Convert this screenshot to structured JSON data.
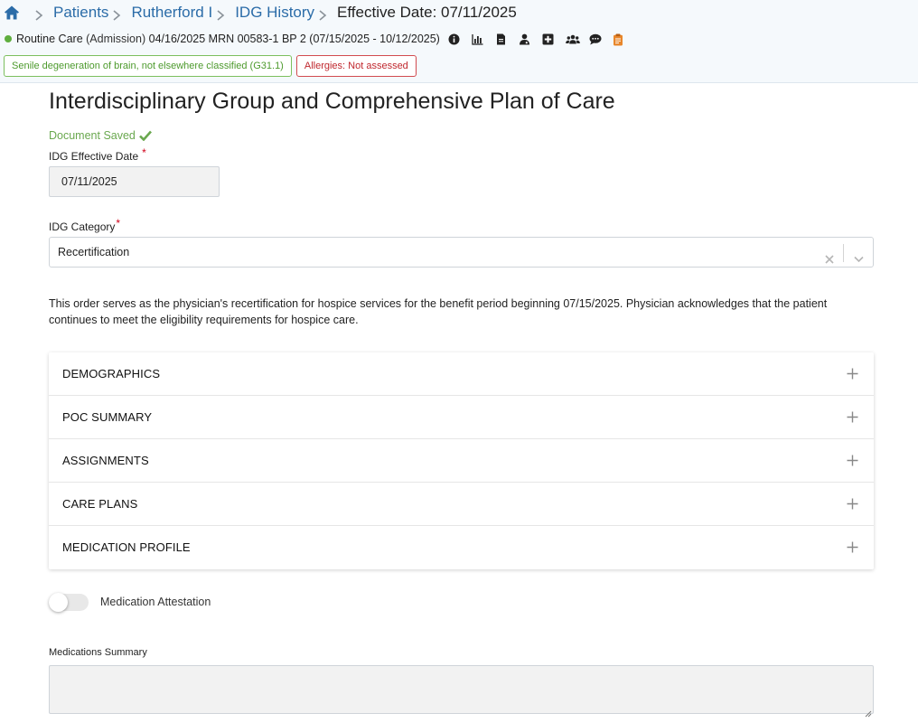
{
  "breadcrumb": {
    "items": [
      "Patients",
      "Rutherford I",
      "IDG History"
    ],
    "current": "Effective Date: 07/11/2025"
  },
  "patient": {
    "care_level": "Routine Care",
    "admission": "(Admission)",
    "details": "04/16/2025 MRN 00583-1 BP 2 (07/15/2025 - 10/12/2025)",
    "diagnosis": "Senile degeneration of brain, not elsewhere classified (G31.1)",
    "allergies": "Allergies: Not assessed",
    "toolbar_icons": [
      "info-icon",
      "chart-icon",
      "document-icon",
      "physician-icon",
      "medical-cross-icon",
      "group-icon",
      "comment-icon",
      "clipboard-icon"
    ]
  },
  "page": {
    "title": "Interdisciplinary Group and Comprehensive Plan of Care",
    "saved_status": "Document Saved"
  },
  "form": {
    "effective_date_label": "IDG Effective Date",
    "effective_date_value": "07/11/2025",
    "category_label": "IDG Category",
    "category_value": "Recertification",
    "recert_note": "This order serves as the physician's recertification for hospice services for the benefit period beginning 07/15/2025. Physician acknowledges that the patient continues to meet the eligibility requirements for hospice care.",
    "required_marker": "*"
  },
  "sections": [
    "DEMOGRAPHICS",
    "POC SUMMARY",
    "ASSIGNMENTS",
    "CARE PLANS",
    "MEDICATION PROFILE"
  ],
  "medication": {
    "attestation_label": "Medication Attestation",
    "attestation_checked": false,
    "summary_label": "Medications Summary",
    "summary_value": ""
  },
  "colors": {
    "link": "#2b6ca8",
    "success": "#6aa84f",
    "alert": "#c0282e",
    "required": "#d0021b",
    "status_dot": "#5fae3e",
    "clipboard": "#e8862a"
  }
}
